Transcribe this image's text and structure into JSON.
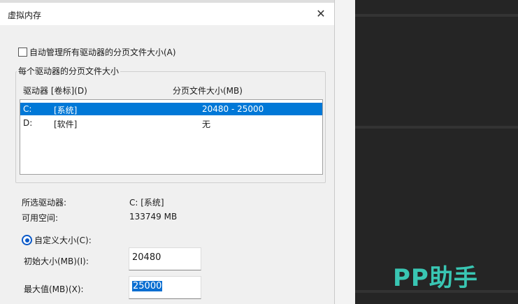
{
  "window": {
    "title": "虚拟内存",
    "close_glyph": "✕"
  },
  "auto_manage": {
    "label": "自动管理所有驱动器的分页文件大小(A)",
    "checked": false
  },
  "drives_group": {
    "legend": "每个驱动器的分页文件大小",
    "col_drive": "驱动器 [卷标](D)",
    "col_size": "分页文件大小(MB)",
    "rows": [
      {
        "drive": "C:",
        "label": "[系统]",
        "size": "20480 - 25000",
        "selected": true
      },
      {
        "drive": "D:",
        "label": "[软件]",
        "size": "无",
        "selected": false
      }
    ]
  },
  "selected_info": {
    "drive_label": "所选驱动器:",
    "drive_value": "C:  [系统]",
    "space_label": "可用空间:",
    "space_value": "133749 MB"
  },
  "custom_size": {
    "radio_label": "自定义大小(C):",
    "selected": true,
    "initial_label": "初始大小(MB)(I):",
    "initial_value": "20480",
    "max_label": "最大值(MB)(X):",
    "max_value": "25000"
  },
  "watermark": "PP助手",
  "colors": {
    "accent": "#0078d7",
    "watermark": "#39c6b3"
  }
}
